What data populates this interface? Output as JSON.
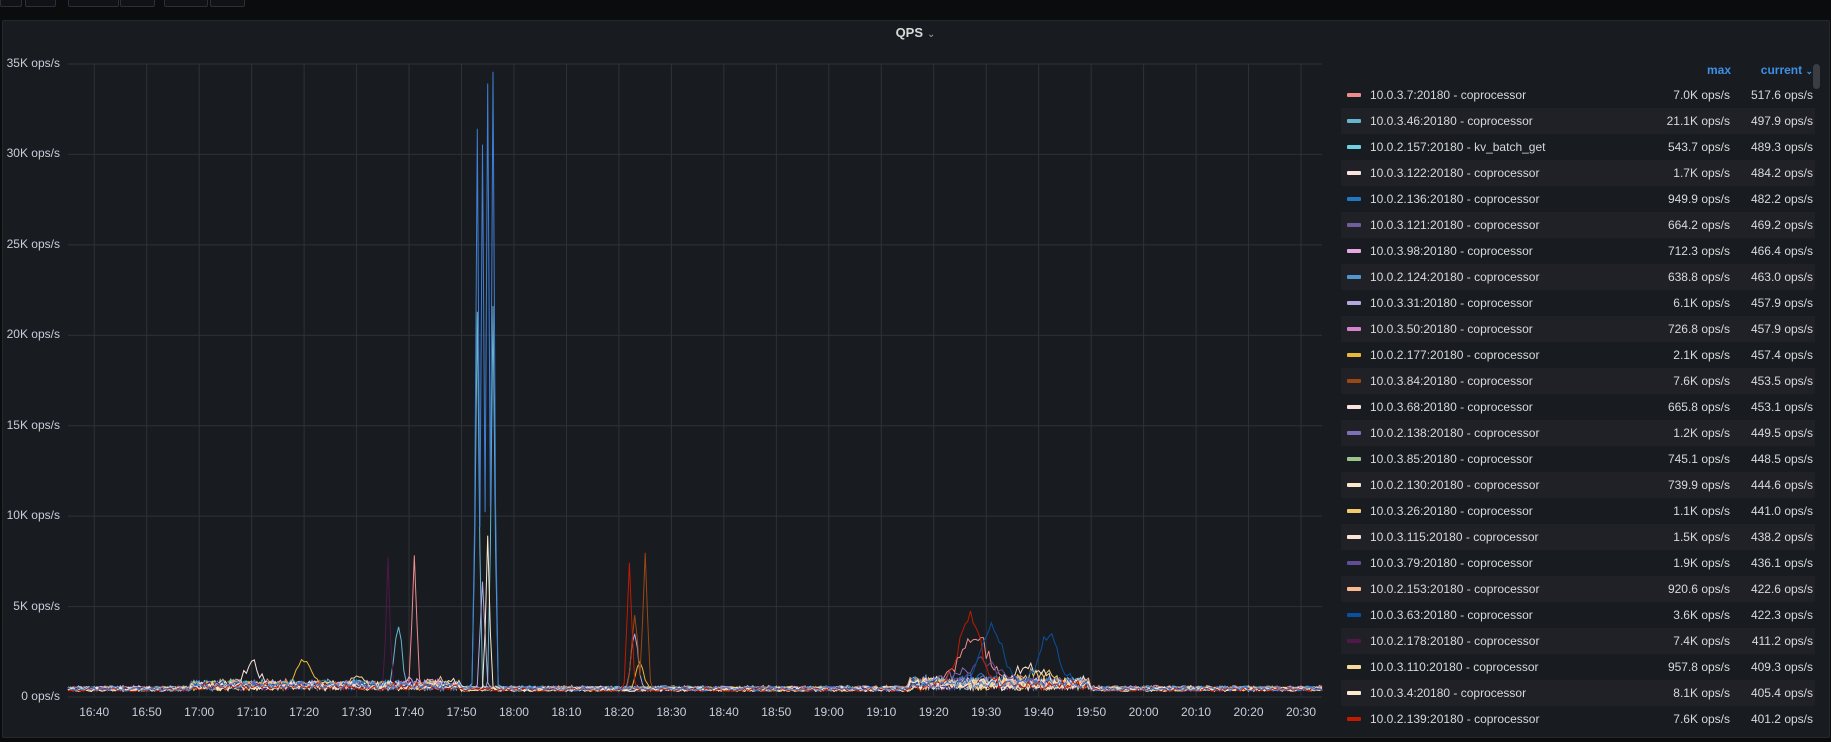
{
  "panel": {
    "title": "QPS"
  },
  "legend": {
    "header_max": "max",
    "header_current": "current",
    "items": [
      {
        "name": "10.0.3.7:20180 - coprocessor",
        "color": "#ef8b8f",
        "max": "7.0K ops/s",
        "current": "517.6 ops/s"
      },
      {
        "name": "10.0.3.46:20180 - coprocessor",
        "color": "#65b5cf",
        "max": "21.1K ops/s",
        "current": "497.9 ops/s"
      },
      {
        "name": "10.0.2.157:20180 - kv_batch_get",
        "color": "#6ed0e0",
        "max": "543.7 ops/s",
        "current": "489.3 ops/s"
      },
      {
        "name": "10.0.3.122:20180 - coprocessor",
        "color": "#fce2de",
        "max": "1.7K ops/s",
        "current": "484.2 ops/s"
      },
      {
        "name": "10.0.2.136:20180 - coprocessor",
        "color": "#1f78c1",
        "max": "949.9 ops/s",
        "current": "482.2 ops/s"
      },
      {
        "name": "10.0.3.121:20180 - coprocessor",
        "color": "#705da0",
        "max": "664.2 ops/s",
        "current": "469.2 ops/s"
      },
      {
        "name": "10.0.3.98:20180 - coprocessor",
        "color": "#e5a8e2",
        "max": "712.3 ops/s",
        "current": "466.4 ops/s"
      },
      {
        "name": "10.0.2.124:20180 - coprocessor",
        "color": "#5195ce",
        "max": "638.8 ops/s",
        "current": "463.0 ops/s"
      },
      {
        "name": "10.0.3.31:20180 - coprocessor",
        "color": "#b3a7e0",
        "max": "6.1K ops/s",
        "current": "457.9 ops/s"
      },
      {
        "name": "10.0.3.50:20180 - coprocessor",
        "color": "#d683ce",
        "max": "726.8 ops/s",
        "current": "457.9 ops/s"
      },
      {
        "name": "10.0.2.177:20180 - coprocessor",
        "color": "#eab839",
        "max": "2.1K ops/s",
        "current": "457.4 ops/s"
      },
      {
        "name": "10.0.3.84:20180 - coprocessor",
        "color": "#9a4714",
        "max": "7.6K ops/s",
        "current": "453.5 ops/s"
      },
      {
        "name": "10.0.3.68:20180 - coprocessor",
        "color": "#fce2de",
        "max": "665.8 ops/s",
        "current": "453.1 ops/s"
      },
      {
        "name": "10.0.2.138:20180 - coprocessor",
        "color": "#806eb7",
        "max": "1.2K ops/s",
        "current": "449.5 ops/s"
      },
      {
        "name": "10.0.3.85:20180 - coprocessor",
        "color": "#9ac48a",
        "max": "745.1 ops/s",
        "current": "448.5 ops/s"
      },
      {
        "name": "10.0.2.130:20180 - coprocessor",
        "color": "#fce6cc",
        "max": "739.9 ops/s",
        "current": "444.6 ops/s"
      },
      {
        "name": "10.0.3.26:20180 - coprocessor",
        "color": "#f2c96d",
        "max": "1.1K ops/s",
        "current": "441.0 ops/s"
      },
      {
        "name": "10.0.3.115:20180 - coprocessor",
        "color": "#fbe3d6",
        "max": "1.5K ops/s",
        "current": "438.2 ops/s"
      },
      {
        "name": "10.0.3.79:20180 - coprocessor",
        "color": "#614d93",
        "max": "1.9K ops/s",
        "current": "436.1 ops/s"
      },
      {
        "name": "10.0.2.153:20180 - coprocessor",
        "color": "#f9ba8f",
        "max": "920.6 ops/s",
        "current": "422.6 ops/s"
      },
      {
        "name": "10.0.3.63:20180 - coprocessor",
        "color": "#0a50a1",
        "max": "3.6K ops/s",
        "current": "422.3 ops/s"
      },
      {
        "name": "10.0.2.178:20180 - coprocessor",
        "color": "#511749",
        "max": "7.4K ops/s",
        "current": "411.2 ops/s"
      },
      {
        "name": "10.0.3.110:20180 - coprocessor",
        "color": "#f7d89a",
        "max": "957.8 ops/s",
        "current": "409.3 ops/s"
      },
      {
        "name": "10.0.3.4:20180 - coprocessor",
        "color": "#fceaca",
        "max": "8.1K ops/s",
        "current": "405.4 ops/s"
      },
      {
        "name": "10.0.2.139:20180 - coprocessor",
        "color": "#bf1b00",
        "max": "7.6K ops/s",
        "current": "401.2 ops/s"
      }
    ]
  },
  "chart_data": {
    "type": "line",
    "title": "QPS",
    "unit": "ops/s",
    "x_range": [
      "16:35",
      "20:34"
    ],
    "ylim": [
      0,
      35000
    ],
    "y_ticks": [
      "0 ops/s",
      "5K ops/s",
      "10K ops/s",
      "15K ops/s",
      "20K ops/s",
      "25K ops/s",
      "30K ops/s",
      "35K ops/s"
    ],
    "y_tick_values": [
      0,
      5000,
      10000,
      15000,
      20000,
      25000,
      30000,
      35000
    ],
    "x_ticks": [
      "16:40",
      "16:50",
      "17:00",
      "17:10",
      "17:20",
      "17:30",
      "17:40",
      "17:50",
      "18:00",
      "18:10",
      "18:20",
      "18:30",
      "18:40",
      "18:50",
      "19:00",
      "19:10",
      "19:20",
      "19:30",
      "19:40",
      "19:50",
      "20:00",
      "20:10",
      "20:20",
      "20:30"
    ],
    "grid": true,
    "legend_position": "right",
    "series_events": [
      [
        [
          "17:41",
          7000,
          0.6
        ],
        [
          "19:28",
          2500,
          4
        ]
      ],
      [
        [
          "17:53",
          20800,
          0.5
        ],
        [
          "17:56",
          21100,
          0.5
        ],
        [
          "17:38",
          3000,
          1
        ]
      ],
      [],
      [
        [
          "17:10",
          1300,
          2
        ]
      ],
      [
        [
          "19:30",
          500,
          5
        ]
      ],
      [
        [
          "19:35",
          200,
          5
        ]
      ],
      [
        [
          "17:40",
          250,
          2
        ]
      ],
      [],
      [
        [
          "17:54",
          6000,
          0.6
        ],
        [
          "18:23",
          3000,
          1
        ]
      ],
      [
        [
          "17:44",
          300,
          2
        ]
      ],
      [
        [
          "17:20",
          1500,
          2
        ],
        [
          "18:24",
          1700,
          1
        ]
      ],
      [
        [
          "18:25",
          7500,
          0.6
        ],
        [
          "18:23",
          4000,
          0.8
        ]
      ],
      [],
      [
        [
          "19:25",
          800,
          4
        ]
      ],
      [
        [
          "17:05",
          300,
          3
        ]
      ],
      [
        [
          "17:48",
          300,
          2
        ]
      ],
      [
        [
          "19:40",
          700,
          4
        ]
      ],
      [
        [
          "19:38",
          1100,
          4
        ]
      ],
      [
        [
          "19:30",
          1500,
          4
        ]
      ],
      [
        [
          "17:45",
          500,
          2
        ]
      ],
      [
        [
          "19:31",
          3200,
          3
        ],
        [
          "19:42",
          2700,
          3
        ]
      ],
      [
        [
          "17:36",
          7300,
          0.5
        ]
      ],
      [
        [
          "17:30",
          550,
          2
        ]
      ],
      [
        [
          "17:55",
          8500,
          0.5
        ]
      ],
      [
        [
          "18:22",
          7000,
          0.6
        ],
        [
          "19:27",
          3800,
          3
        ]
      ]
    ],
    "extra_series": [
      {
        "color": "#3f7fd6",
        "events": [
          [
            "17:53",
            31000,
            0.45
          ],
          [
            "17:54",
            30000,
            0.45
          ],
          [
            "17:55",
            33500,
            0.45
          ],
          [
            "17:56",
            34200,
            0.45
          ]
        ]
      }
    ]
  }
}
